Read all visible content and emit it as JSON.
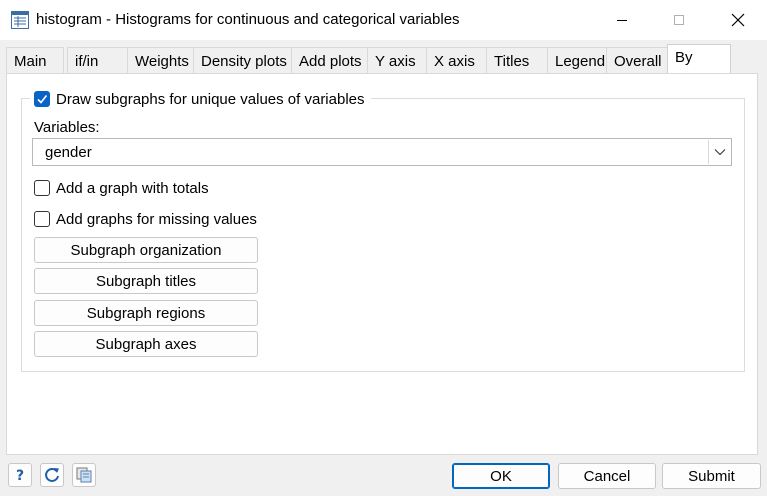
{
  "window": {
    "title": "histogram - Histograms for continuous and categorical variables"
  },
  "tabs": [
    {
      "label": "Main"
    },
    {
      "label": "if/in"
    },
    {
      "label": "Weights"
    },
    {
      "label": "Density plots"
    },
    {
      "label": "Add plots"
    },
    {
      "label": "Y axis"
    },
    {
      "label": "X axis"
    },
    {
      "label": "Titles"
    },
    {
      "label": "Legend"
    },
    {
      "label": "Overall"
    },
    {
      "label": "By"
    }
  ],
  "active_tab": "By",
  "by": {
    "draw_subgraphs": {
      "label": "Draw subgraphs for unique values of variables",
      "checked": true
    },
    "variables_label": "Variables:",
    "variables_value": "gender",
    "add_totals": {
      "label": "Add a graph with totals",
      "checked": false
    },
    "add_missing": {
      "label": "Add graphs for missing values",
      "checked": false
    },
    "buttons": {
      "organization": "Subgraph organization",
      "titles": "Subgraph titles",
      "regions": "Subgraph regions",
      "axes": "Subgraph axes"
    }
  },
  "footer": {
    "help_icon": "help-icon",
    "reset_icon": "reset-icon",
    "copy_icon": "copy-command-icon",
    "ok": "OK",
    "cancel": "Cancel",
    "submit": "Submit"
  },
  "colors": {
    "accent": "#0a64c8",
    "default_button_border": "#0067c0",
    "window_bg": "#f0f0f0",
    "panel_bg": "#ffffff"
  }
}
